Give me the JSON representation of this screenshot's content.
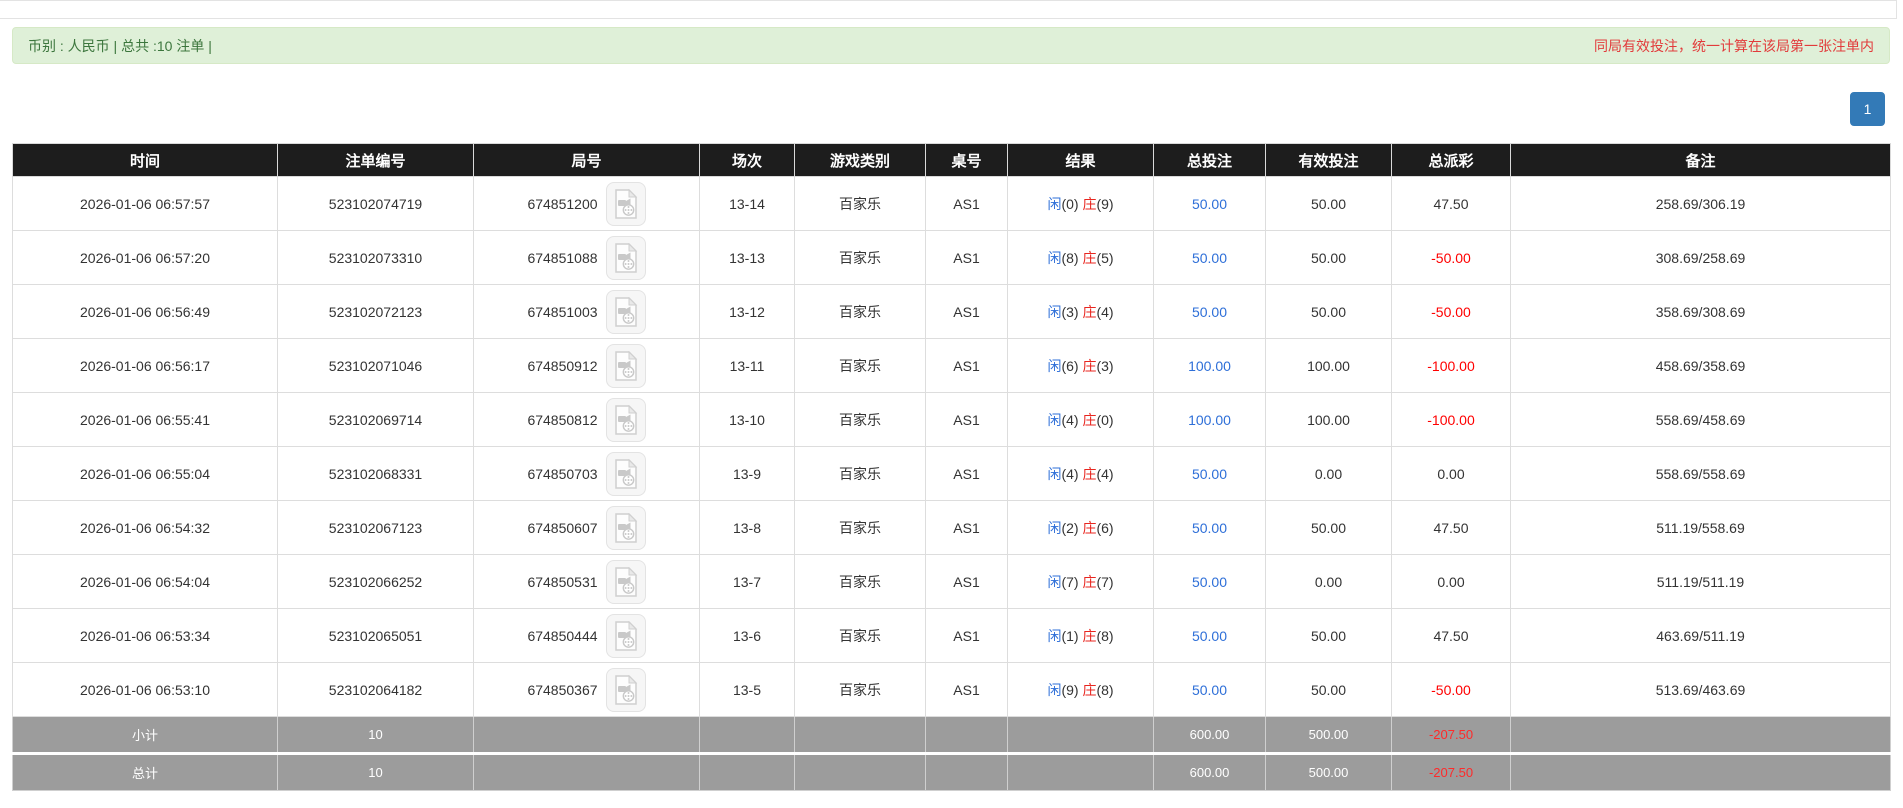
{
  "banner": {
    "left_text": "币别 : 人民币 | 总共 :10 注单 |",
    "right_note": "同局有效投注，统一计算在该局第一张注单内"
  },
  "pagination": {
    "current_page": "1"
  },
  "colors": {
    "banner_bg": "#dff0d8",
    "banner_text": "#3c763d",
    "note_red": "#e23b3b",
    "header_bg": "#1d1d1d",
    "link_blue": "#2e6fd8",
    "banker_red": "#e8261f",
    "negative_red": "#ff0000",
    "footer_gray": "#9c9c9c",
    "pagination_blue": "#337ab7"
  },
  "table": {
    "headers": [
      "时间",
      "注单编号",
      "局号",
      "场次",
      "游戏类别",
      "桌号",
      "结果",
      "总投注",
      "有效投注",
      "总派彩",
      "备注"
    ],
    "video_icon_name": "video-file-icon",
    "rows": [
      {
        "time": "2026-01-06 06:57:57",
        "bet_id": "523102074719",
        "round_id": "674851200",
        "session": "13-14",
        "game_type": "百家乐",
        "table_no": "AS1",
        "result": {
          "player": "闲",
          "player_pts": "(0)",
          "banker": "庄",
          "banker_pts": "(9)"
        },
        "total_bet": "50.00",
        "valid_bet": "50.00",
        "payout": "47.50",
        "note": "258.69/306.19"
      },
      {
        "time": "2026-01-06 06:57:20",
        "bet_id": "523102073310",
        "round_id": "674851088",
        "session": "13-13",
        "game_type": "百家乐",
        "table_no": "AS1",
        "result": {
          "player": "闲",
          "player_pts": "(8)",
          "banker": "庄",
          "banker_pts": "(5)"
        },
        "total_bet": "50.00",
        "valid_bet": "50.00",
        "payout": "-50.00",
        "note": "308.69/258.69"
      },
      {
        "time": "2026-01-06 06:56:49",
        "bet_id": "523102072123",
        "round_id": "674851003",
        "session": "13-12",
        "game_type": "百家乐",
        "table_no": "AS1",
        "result": {
          "player": "闲",
          "player_pts": "(3)",
          "banker": "庄",
          "banker_pts": "(4)"
        },
        "total_bet": "50.00",
        "valid_bet": "50.00",
        "payout": "-50.00",
        "note": "358.69/308.69"
      },
      {
        "time": "2026-01-06 06:56:17",
        "bet_id": "523102071046",
        "round_id": "674850912",
        "session": "13-11",
        "game_type": "百家乐",
        "table_no": "AS1",
        "result": {
          "player": "闲",
          "player_pts": "(6)",
          "banker": "庄",
          "banker_pts": "(3)"
        },
        "total_bet": "100.00",
        "valid_bet": "100.00",
        "payout": "-100.00",
        "note": "458.69/358.69"
      },
      {
        "time": "2026-01-06 06:55:41",
        "bet_id": "523102069714",
        "round_id": "674850812",
        "session": "13-10",
        "game_type": "百家乐",
        "table_no": "AS1",
        "result": {
          "player": "闲",
          "player_pts": "(4)",
          "banker": "庄",
          "banker_pts": "(0)"
        },
        "total_bet": "100.00",
        "valid_bet": "100.00",
        "payout": "-100.00",
        "note": "558.69/458.69"
      },
      {
        "time": "2026-01-06 06:55:04",
        "bet_id": "523102068331",
        "round_id": "674850703",
        "session": "13-9",
        "game_type": "百家乐",
        "table_no": "AS1",
        "result": {
          "player": "闲",
          "player_pts": "(4)",
          "banker": "庄",
          "banker_pts": "(4)"
        },
        "total_bet": "50.00",
        "valid_bet": "0.00",
        "payout": "0.00",
        "note": "558.69/558.69"
      },
      {
        "time": "2026-01-06 06:54:32",
        "bet_id": "523102067123",
        "round_id": "674850607",
        "session": "13-8",
        "game_type": "百家乐",
        "table_no": "AS1",
        "result": {
          "player": "闲",
          "player_pts": "(2)",
          "banker": "庄",
          "banker_pts": "(6)"
        },
        "total_bet": "50.00",
        "valid_bet": "50.00",
        "payout": "47.50",
        "note": "511.19/558.69"
      },
      {
        "time": "2026-01-06 06:54:04",
        "bet_id": "523102066252",
        "round_id": "674850531",
        "session": "13-7",
        "game_type": "百家乐",
        "table_no": "AS1",
        "result": {
          "player": "闲",
          "player_pts": "(7)",
          "banker": "庄",
          "banker_pts": "(7)"
        },
        "total_bet": "50.00",
        "valid_bet": "0.00",
        "payout": "0.00",
        "note": "511.19/511.19"
      },
      {
        "time": "2026-01-06 06:53:34",
        "bet_id": "523102065051",
        "round_id": "674850444",
        "session": "13-6",
        "game_type": "百家乐",
        "table_no": "AS1",
        "result": {
          "player": "闲",
          "player_pts": "(1)",
          "banker": "庄",
          "banker_pts": "(8)"
        },
        "total_bet": "50.00",
        "valid_bet": "50.00",
        "payout": "47.50",
        "note": "463.69/511.19"
      },
      {
        "time": "2026-01-06 06:53:10",
        "bet_id": "523102064182",
        "round_id": "674850367",
        "session": "13-5",
        "game_type": "百家乐",
        "table_no": "AS1",
        "result": {
          "player": "闲",
          "player_pts": "(9)",
          "banker": "庄",
          "banker_pts": "(8)"
        },
        "total_bet": "50.00",
        "valid_bet": "50.00",
        "payout": "-50.00",
        "note": "513.69/463.69"
      }
    ],
    "subtotal": {
      "label": "小计",
      "count": "10",
      "total_bet": "600.00",
      "valid_bet": "500.00",
      "payout": "-207.50"
    },
    "total": {
      "label": "总计",
      "count": "10",
      "total_bet": "600.00",
      "valid_bet": "500.00",
      "payout": "-207.50"
    }
  }
}
